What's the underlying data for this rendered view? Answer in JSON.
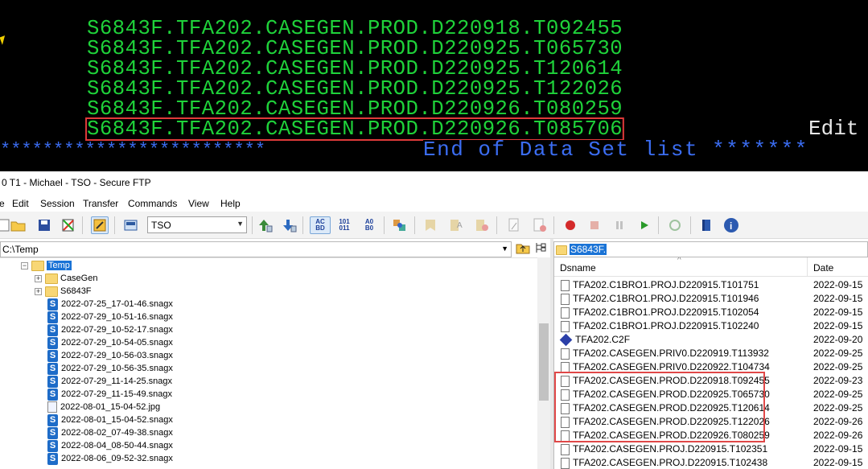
{
  "terminal": {
    "lines": [
      "S6843F.TFA202.CASEGEN.PROD.D220918.T092455",
      "S6843F.TFA202.CASEGEN.PROD.D220925.T065730",
      "S6843F.TFA202.CASEGEN.PROD.D220925.T120614",
      "S6843F.TFA202.CASEGEN.PROD.D220925.T122026",
      "S6843F.TFA202.CASEGEN.PROD.D220926.T080259",
      "S6843F.TFA202.CASEGEN.PROD.D220926.T085706"
    ],
    "edit_label": "Edit",
    "stars_left": "*************************",
    "end_label": "End of Data Set list",
    "stars_right": "*******",
    "text_color": "#1fd23a",
    "footer_color": "#3b6df2",
    "highlight_color": "#e03a3a"
  },
  "window": {
    "title": "0 T1 - Michael - TSO - Secure FTP"
  },
  "menu": [
    "e",
    "Edit",
    "Session",
    "Transfer",
    "Commands",
    "View",
    "Help"
  ],
  "toolbar": {
    "profile_value": "TSO"
  },
  "left_pane": {
    "path": "C:\\Temp",
    "root_label": "Temp",
    "folders": [
      "CaseGen",
      "S6843F"
    ],
    "files": [
      "2022-07-25_17-01-46.snagx",
      "2022-07-29_10-51-16.snagx",
      "2022-07-29_10-52-17.snagx",
      "2022-07-29_10-54-05.snagx",
      "2022-07-29_10-56-03.snagx",
      "2022-07-29_10-56-35.snagx",
      "2022-07-29_11-14-25.snagx",
      "2022-07-29_11-15-49.snagx",
      "2022-08-01_15-04-52.jpg",
      "2022-08-01_15-04-52.snagx",
      "2022-08-02_07-49-38.snagx",
      "2022-08-04_08-50-44.snagx",
      "2022-08-06_09-52-32.snagx"
    ]
  },
  "right_pane": {
    "path": "S6843F.",
    "col_dsname": "Dsname",
    "col_date": "Date",
    "rows": [
      {
        "name": "TFA202.C1BRO1.PROJ.D220915.T101751",
        "date": "2022-09-15",
        "icon": "doc"
      },
      {
        "name": "TFA202.C1BRO1.PROJ.D220915.T101946",
        "date": "2022-09-15",
        "icon": "doc"
      },
      {
        "name": "TFA202.C1BRO1.PROJ.D220915.T102054",
        "date": "2022-09-15",
        "icon": "doc"
      },
      {
        "name": "TFA202.C1BRO1.PROJ.D220915.T102240",
        "date": "2022-09-15",
        "icon": "doc"
      },
      {
        "name": "TFA202.C2F",
        "date": "2022-09-20",
        "icon": "dia"
      },
      {
        "name": "TFA202.CASEGEN.PRIV0.D220919.T113932",
        "date": "2022-09-25",
        "icon": "doc"
      },
      {
        "name": "TFA202.CASEGEN.PRIV0.D220922.T104734",
        "date": "2022-09-25",
        "icon": "doc"
      },
      {
        "name": "TFA202.CASEGEN.PROD.D220918.T092455",
        "date": "2022-09-23",
        "icon": "doc"
      },
      {
        "name": "TFA202.CASEGEN.PROD.D220925.T065730",
        "date": "2022-09-25",
        "icon": "doc"
      },
      {
        "name": "TFA202.CASEGEN.PROD.D220925.T120614",
        "date": "2022-09-25",
        "icon": "doc"
      },
      {
        "name": "TFA202.CASEGEN.PROD.D220925.T122026",
        "date": "2022-09-26",
        "icon": "doc"
      },
      {
        "name": "TFA202.CASEGEN.PROD.D220926.T080259",
        "date": "2022-09-26",
        "icon": "doc"
      },
      {
        "name": "TFA202.CASEGEN.PROJ.D220915.T102351",
        "date": "2022-09-15",
        "icon": "doc"
      },
      {
        "name": "TFA202.CASEGEN.PROJ.D220915.T102438",
        "date": "2022-09-15",
        "icon": "doc"
      }
    ]
  }
}
